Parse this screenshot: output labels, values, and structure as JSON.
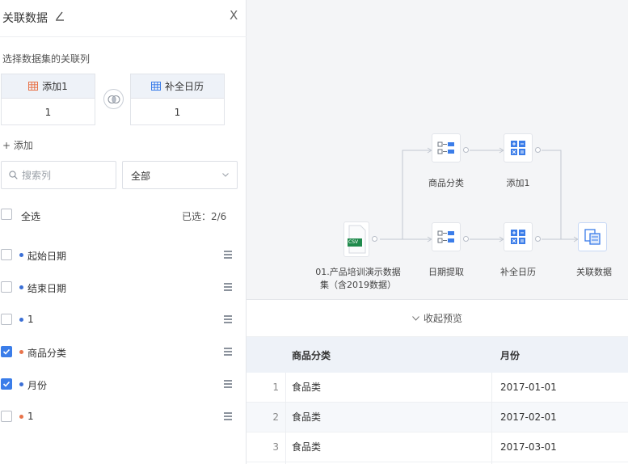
{
  "panel": {
    "title": "关联数据",
    "close": "X",
    "section_label": "选择数据集的关联列",
    "left_dataset": {
      "name": "添加1",
      "value": "1",
      "icon_color": "#e8734a"
    },
    "right_dataset": {
      "name": "补全日历",
      "value": "1",
      "icon_color": "#3b7de9"
    },
    "add_label": "+ 添加",
    "search_placeholder": "搜索列",
    "filter_value": "全部",
    "select_all_label": "全选",
    "selected_count": "已选：2/6",
    "fields": [
      {
        "name": "起始日期",
        "checked": false,
        "dot_color": "#3b6fd6"
      },
      {
        "name": "结束日期",
        "checked": false,
        "dot_color": "#3b6fd6"
      },
      {
        "name": "1",
        "checked": false,
        "dot_color": "#3b6fd6"
      },
      {
        "name": "商品分类",
        "checked": true,
        "dot_color": "#e8734a"
      },
      {
        "name": "月份",
        "checked": true,
        "dot_color": "#3b6fd6"
      },
      {
        "name": "1",
        "checked": false,
        "dot_color": "#e8734a"
      }
    ]
  },
  "flow": {
    "nodes": [
      {
        "id": "source",
        "label_line1": "01.产品培训演示数据",
        "label_line2": "集（含2019数据）",
        "icon": "csv-file-icon"
      },
      {
        "id": "category",
        "label": "商品分类",
        "icon": "split-columns-icon"
      },
      {
        "id": "date_extract",
        "label": "日期提取",
        "icon": "split-columns-icon"
      },
      {
        "id": "add1",
        "label": "添加1",
        "icon": "calculator-icon"
      },
      {
        "id": "fill_calendar",
        "label": "补全日历",
        "icon": "calculator-icon"
      },
      {
        "id": "join",
        "label": "关联数据",
        "icon": "join-data-icon"
      }
    ],
    "csv_badge": "CSV"
  },
  "preview": {
    "collapse_label": "收起预览",
    "columns": [
      "商品分类",
      "月份"
    ],
    "rows": [
      {
        "index": "1",
        "category": "食品类",
        "month": "2017-01-01"
      },
      {
        "index": "2",
        "category": "食品类",
        "month": "2017-02-01"
      },
      {
        "index": "3",
        "category": "食品类",
        "month": "2017-03-01"
      }
    ]
  },
  "colors": {
    "accent": "#3b7de9",
    "orange": "#e8734a",
    "header_bg": "#eef2f8"
  }
}
